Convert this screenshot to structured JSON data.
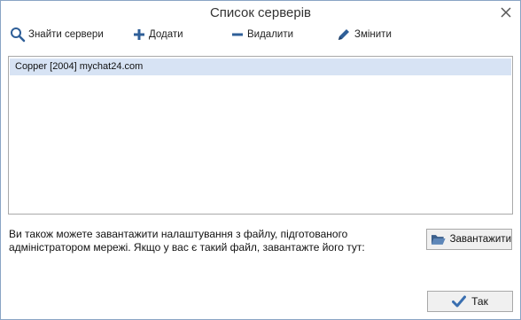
{
  "window": {
    "title": "Список серверів"
  },
  "toolbar": {
    "find_label": "Знайти сервери",
    "add_label": "Додати",
    "delete_label": "Видалити",
    "edit_label": "Змінити"
  },
  "server_list": {
    "items": [
      {
        "label": "Copper [2004] mychat24.com",
        "selected": true
      }
    ]
  },
  "info": {
    "line1": "Ви також можете завантажити налаштування з файлу, підготованого",
    "line2": "адміністратором мережі. Якщо у вас є такий файл, завантажте його тут:"
  },
  "buttons": {
    "load_label": "Завантажити",
    "ok_label": "Так"
  },
  "colors": {
    "selection": "#d7e3f4",
    "icon_blue": "#2f5f98",
    "check_blue": "#3a6fb0"
  },
  "icons": {
    "close": "close-icon",
    "find": "search-icon",
    "add": "plus-icon",
    "delete": "minus-icon",
    "edit": "pencil-icon",
    "load": "folder-open-icon",
    "ok": "checkmark-icon"
  }
}
